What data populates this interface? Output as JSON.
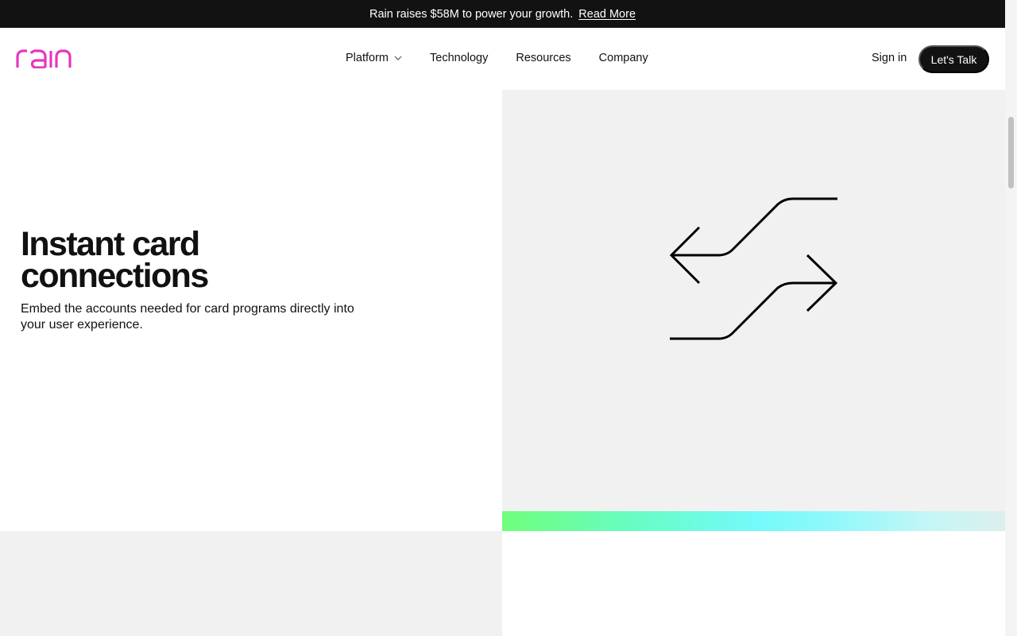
{
  "announcement": {
    "text": "Rain raises $58M to power your growth.",
    "link": "Read More"
  },
  "brand": {
    "name": "rain",
    "color": "#e637bf"
  },
  "nav": {
    "items": [
      {
        "label": "Platform",
        "dropdown": true
      },
      {
        "label": "Technology"
      },
      {
        "label": "Resources"
      },
      {
        "label": "Company"
      }
    ],
    "signin": "Sign in",
    "cta": "Let's Talk"
  },
  "hero": {
    "title_line1": "Instant card",
    "title_line2": "connections",
    "subtitle": "Embed the accounts needed for card programs directly into your user experience.",
    "illustration": "bidirectional-arrows-icon"
  },
  "colors": {
    "dark": "#121212",
    "panel": "#f1f1f1",
    "gradient": [
      "#6ffe7c",
      "#73fafa",
      "#dcefec"
    ]
  }
}
